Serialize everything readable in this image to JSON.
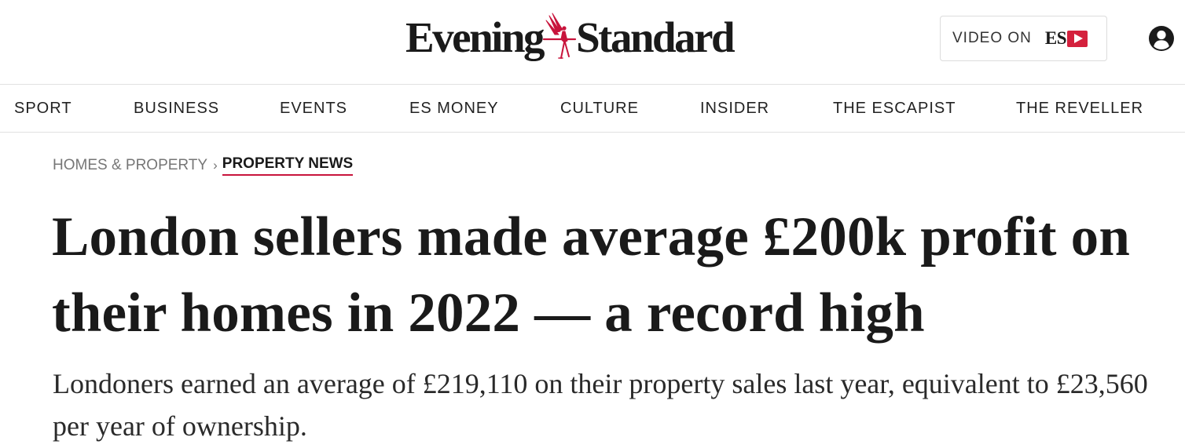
{
  "header": {
    "logo_left": "Evening",
    "logo_right": "Standard",
    "video_label": "VIDEO ON",
    "video_brand": "ES",
    "emblem_icon": "winged-figure-icon",
    "account_icon": "user-account-icon",
    "brand_red": "#d4213d"
  },
  "nav": {
    "items": [
      "SPORT",
      "BUSINESS",
      "EVENTS",
      "ES MONEY",
      "CULTURE",
      "INSIDER",
      "THE ESCAPIST",
      "THE REVELLER"
    ]
  },
  "breadcrumb": {
    "parent": "HOMES & PROPERTY",
    "separator": "›",
    "current": "PROPERTY NEWS",
    "accent": "#c8143c"
  },
  "article": {
    "headline": "London sellers made average £200k profit on their homes in 2022 — a record high",
    "standfirst": "Londoners earned an average of £219,110 on their property sales last year, equivalent to £23,560 per year of ownership."
  }
}
